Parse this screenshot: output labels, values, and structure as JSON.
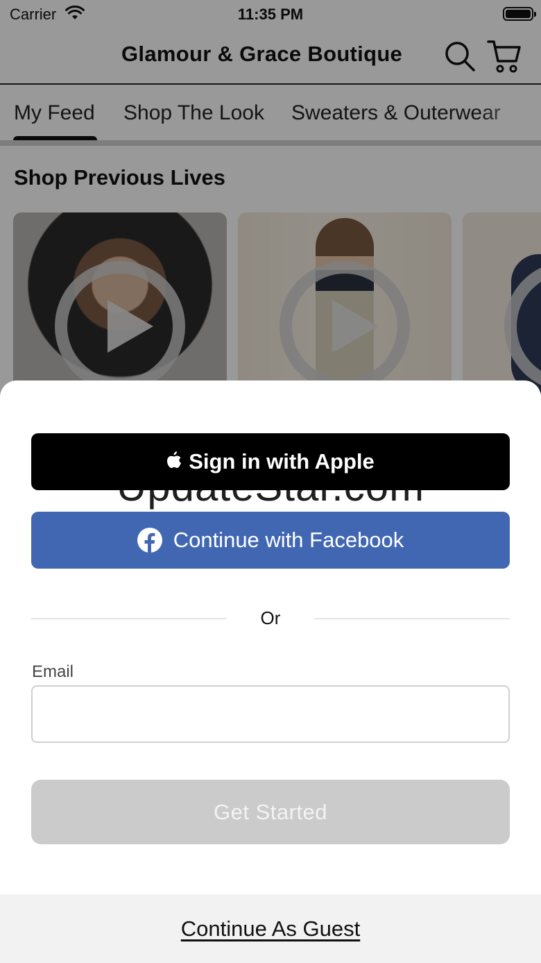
{
  "status_bar": {
    "carrier": "Carrier",
    "time": "11:35 PM"
  },
  "header": {
    "title": "Glamour & Grace Boutique",
    "icons": [
      "search-icon",
      "cart-icon"
    ]
  },
  "tabs": [
    {
      "label": "My Feed",
      "selected": true
    },
    {
      "label": "Shop The Look",
      "selected": false
    },
    {
      "label": "Sweaters & Outerwear",
      "selected": false
    }
  ],
  "feed": {
    "section_title": "Shop Previous Lives",
    "video_count_visible": 3
  },
  "sheet": {
    "apple_button": "Sign in with Apple",
    "facebook_button": "Continue with Facebook",
    "divider_text": "Or",
    "email_label": "Email",
    "email_value": "",
    "email_placeholder": "",
    "get_started_button": "Get Started",
    "guest_link": "Continue As Guest"
  },
  "watermark": "UpdateStar.com",
  "colors": {
    "apple_bg": "#000000",
    "facebook_bg": "#4267b2",
    "get_started_disabled_bg": "#cbcbcb",
    "guest_bar_bg": "#f2f2f2"
  }
}
